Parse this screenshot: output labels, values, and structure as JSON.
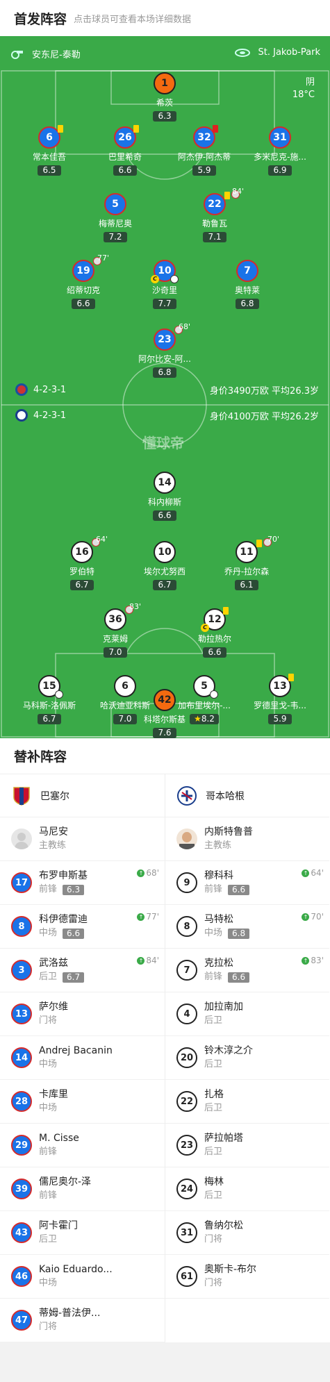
{
  "header": {
    "title": "首发阵容",
    "subtitle": "点击球员可查看本场详细数据"
  },
  "pitch": {
    "home_stadium_label": "安东尼-泰勒",
    "venue": "St. Jakob-Park",
    "weather": "阴",
    "temperature": "18°C",
    "watermark": "懂球帝",
    "home_formation": "4-2-3-1",
    "home_value": "身价3490万欧 平均26.3岁",
    "away_formation": "4-2-3-1",
    "away_value": "身价4100万欧 平均26.2岁"
  },
  "home_players": [
    {
      "num": "1",
      "name": "希茨",
      "rating": "6.3"
    },
    {
      "num": "6",
      "name": "常本佳吾",
      "rating": "6.5"
    },
    {
      "num": "26",
      "name": "巴里希奇",
      "rating": "6.6"
    },
    {
      "num": "32",
      "name": "阿杰伊-阿杰蒂",
      "rating": "5.9"
    },
    {
      "num": "31",
      "name": "多米尼克-施...",
      "rating": "6.9"
    },
    {
      "num": "5",
      "name": "梅蒂尼奥",
      "rating": "7.2"
    },
    {
      "num": "22",
      "name": "勒鲁瓦",
      "rating": "7.1",
      "sub": "84'"
    },
    {
      "num": "19",
      "name": "绍蒂切克",
      "rating": "6.6",
      "sub": "77'"
    },
    {
      "num": "10",
      "name": "沙奇里",
      "rating": "7.7"
    },
    {
      "num": "7",
      "name": "奥特莱",
      "rating": "6.8"
    },
    {
      "num": "23",
      "name": "阿尔比安-阿...",
      "rating": "6.8",
      "sub": "68'"
    }
  ],
  "away_players": [
    {
      "num": "14",
      "name": "科内柳斯",
      "rating": "6.6"
    },
    {
      "num": "16",
      "name": "罗伯特",
      "rating": "6.7",
      "sub": "64'"
    },
    {
      "num": "10",
      "name": "埃尔尤努西",
      "rating": "6.7"
    },
    {
      "num": "11",
      "name": "乔丹-拉尔森",
      "rating": "6.1",
      "sub": "70'"
    },
    {
      "num": "36",
      "name": "克莱姆",
      "rating": "7.0",
      "sub": "83'"
    },
    {
      "num": "12",
      "name": "勒拉热尔",
      "rating": "6.6"
    },
    {
      "num": "15",
      "name": "马科斯-洛佩斯",
      "rating": "6.7"
    },
    {
      "num": "6",
      "name": "哈沃迪亚科斯",
      "rating": "7.0"
    },
    {
      "num": "5",
      "name": "加布里埃尔-...",
      "rating": "8.2"
    },
    {
      "num": "13",
      "name": "罗德里戈-韦...",
      "rating": "5.9"
    },
    {
      "num": "42",
      "name": "科塔尔斯基",
      "rating": "7.6"
    }
  ],
  "subs": {
    "title": "替补阵容",
    "home_team": "巴塞尔",
    "away_team": "哥本哈根",
    "home_coach": {
      "name": "马尼安",
      "role": "主教练"
    },
    "away_coach": {
      "name": "内斯特鲁普",
      "role": "主教练"
    },
    "home": [
      {
        "num": "17",
        "name": "布罗申斯基",
        "pos": "前锋",
        "rating": "6.3",
        "in": "68'"
      },
      {
        "num": "8",
        "name": "科伊德雷迪",
        "pos": "中场",
        "rating": "6.6",
        "in": "77'"
      },
      {
        "num": "3",
        "name": "武洛兹",
        "pos": "后卫",
        "rating": "6.7",
        "in": "84'"
      },
      {
        "num": "13",
        "name": "萨尔维",
        "pos": "门将"
      },
      {
        "num": "14",
        "name": "Andrej Bacanin",
        "pos": "中场"
      },
      {
        "num": "28",
        "name": "卡库里",
        "pos": "中场"
      },
      {
        "num": "29",
        "name": "M. Cisse",
        "pos": "前锋"
      },
      {
        "num": "39",
        "name": "儒尼奥尔-泽",
        "pos": "前锋"
      },
      {
        "num": "43",
        "name": "阿卡霍门",
        "pos": "后卫"
      },
      {
        "num": "46",
        "name": "Kaio Eduardo...",
        "pos": "中场"
      },
      {
        "num": "47",
        "name": "蒂姆-普法伊...",
        "pos": "门将"
      }
    ],
    "away": [
      {
        "num": "9",
        "name": "穆科科",
        "pos": "前锋",
        "rating": "6.6",
        "in": "64'"
      },
      {
        "num": "8",
        "name": "马特松",
        "pos": "中场",
        "rating": "6.8",
        "in": "70'"
      },
      {
        "num": "7",
        "name": "克拉松",
        "pos": "前锋",
        "rating": "6.6",
        "in": "83'"
      },
      {
        "num": "4",
        "name": "加拉南加",
        "pos": "后卫"
      },
      {
        "num": "20",
        "name": "铃木淳之介",
        "pos": "后卫"
      },
      {
        "num": "22",
        "name": "扎格",
        "pos": "后卫"
      },
      {
        "num": "23",
        "name": "萨拉帕塔",
        "pos": "后卫"
      },
      {
        "num": "24",
        "name": "梅林",
        "pos": "后卫"
      },
      {
        "num": "31",
        "name": "鲁纳尔松",
        "pos": "门将"
      },
      {
        "num": "61",
        "name": "奥斯卡-布尔",
        "pos": "门将"
      }
    ]
  },
  "colors": {
    "pitch": "#3aaa48",
    "home": "#1a73e8",
    "home_border": "#d52b2b",
    "gk": "#f46a10"
  },
  "icons": [
    "whistle-icon",
    "stadium-icon",
    "yellow-card-icon",
    "red-card-icon",
    "sub-out-icon",
    "sub-in-icon",
    "captain-icon",
    "ball-icon",
    "star-icon"
  ]
}
